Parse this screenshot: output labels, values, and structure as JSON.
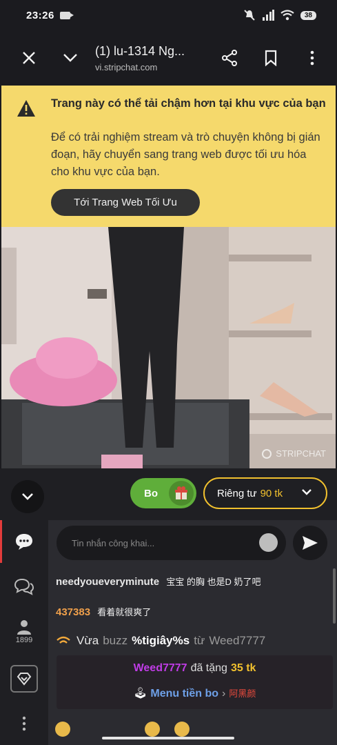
{
  "status_bar": {
    "time": "23:26",
    "battery": "38"
  },
  "toolbar": {
    "title": "(1) lu-1314 Ng...",
    "url": "vi.stripchat.com"
  },
  "banner": {
    "title": "Trang này có thể tải chậm hơn tại khu vực của bạn",
    "body": "Để có trải nghiệm stream và trò chuyện không bị gián đoạn, hãy chuyển sang trang web được tối ưu hóa cho khu vực của bạn.",
    "button": "Tới Trang Web Tối Ưu"
  },
  "video": {
    "watermark": "STRIPCHAT"
  },
  "controls": {
    "tip_label": "Bo",
    "private_label": "Riêng tư",
    "private_price": "90 tk"
  },
  "rail": {
    "viewer_count": "1899"
  },
  "chat": {
    "input_placeholder": "Tin nhắn công khai...",
    "messages": [
      {
        "user": "needyoueveryminute",
        "text": "宝宝 的胸 也是D 奶了吧"
      },
      {
        "user": "437383",
        "text": "看着就很爽了"
      }
    ],
    "buzz": {
      "prefix": "Vừa",
      "action": "buzz",
      "value": "%tigiây%s",
      "from": "từ",
      "user": "Weed7777"
    },
    "tip": {
      "user": "Weed7777",
      "middle": "đã tặng",
      "amount": "35 tk",
      "menu": "Menu tiền bo",
      "item": "阿黑颜"
    }
  },
  "colors": {
    "banner": "#f5d96c",
    "tip_green": "#5fae3a",
    "private_gold": "#f2c12e",
    "chat_bg": "#2b2b30"
  }
}
